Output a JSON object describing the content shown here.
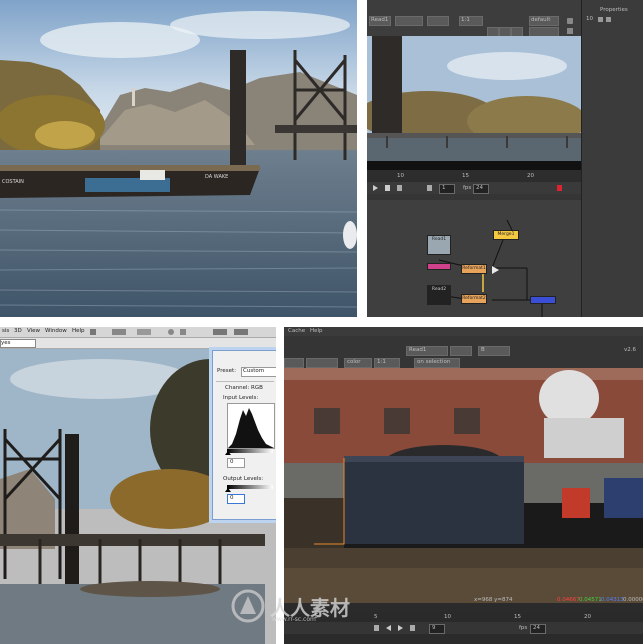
{
  "top_left": {
    "boat_hull_text_left": "COSTAIN",
    "boat_hull_text_right": "DA WAKE"
  },
  "top_right": {
    "viewer_channel": "rgba",
    "viewer_input": "Read1",
    "viewer_zoom": "1:1",
    "viewer_lut": "default",
    "timeline_ticks": [
      "10",
      "15",
      "20"
    ],
    "timeline_frame": "1",
    "fps_label": "fps",
    "fps_value": "24",
    "properties_title": "Properties",
    "properties_count": "10",
    "nodes": [
      "Merge1",
      "Read1",
      "Reformat1",
      "Read2",
      "Reformat2",
      "Read3"
    ]
  },
  "bottom_left": {
    "menu_items": [
      "sis",
      "3D",
      "View",
      "Window",
      "Help"
    ],
    "document_tab": "yes",
    "levels_dialog": {
      "preset_label": "Preset:",
      "preset_value": "Custom",
      "channel_label": "Channel:",
      "channel_value": "RGB",
      "input_levels_label": "Input Levels:",
      "input_black_value": "0",
      "output_levels_label": "Output Levels:",
      "output_black_value": "0"
    }
  },
  "bottom_right": {
    "menu_items": [
      "Cache",
      "Help"
    ],
    "viewer_input": "Read1",
    "viewer_input_b": "B",
    "viewer_channel": "rgba",
    "viewer_mode": "color",
    "viewer_zoom": "1:1",
    "viewer_scale": "v2.6",
    "selection_label": "on selection",
    "cursor_readout": "x=968 y=874",
    "rgb_values": [
      "0.04667",
      "0.04571",
      "0.04313",
      "0.00000"
    ],
    "timeline_ticks": [
      "1",
      "5",
      "10",
      "15",
      "20"
    ],
    "frame_value": "9",
    "fps_label": "fps",
    "fps_value": "24",
    "watermark_brand": "人人素材",
    "watermark_url": "www.rr-sc.com"
  },
  "colors": {
    "app_dark": "#353535",
    "app_darker": "#2b2b2b",
    "node_orange": "#e8a35a",
    "node_yellow": "#f5c842",
    "node_pink": "#d0418c",
    "node_blue": "#3a4fd6",
    "photoshop_chrome": "#bdbdbd"
  }
}
